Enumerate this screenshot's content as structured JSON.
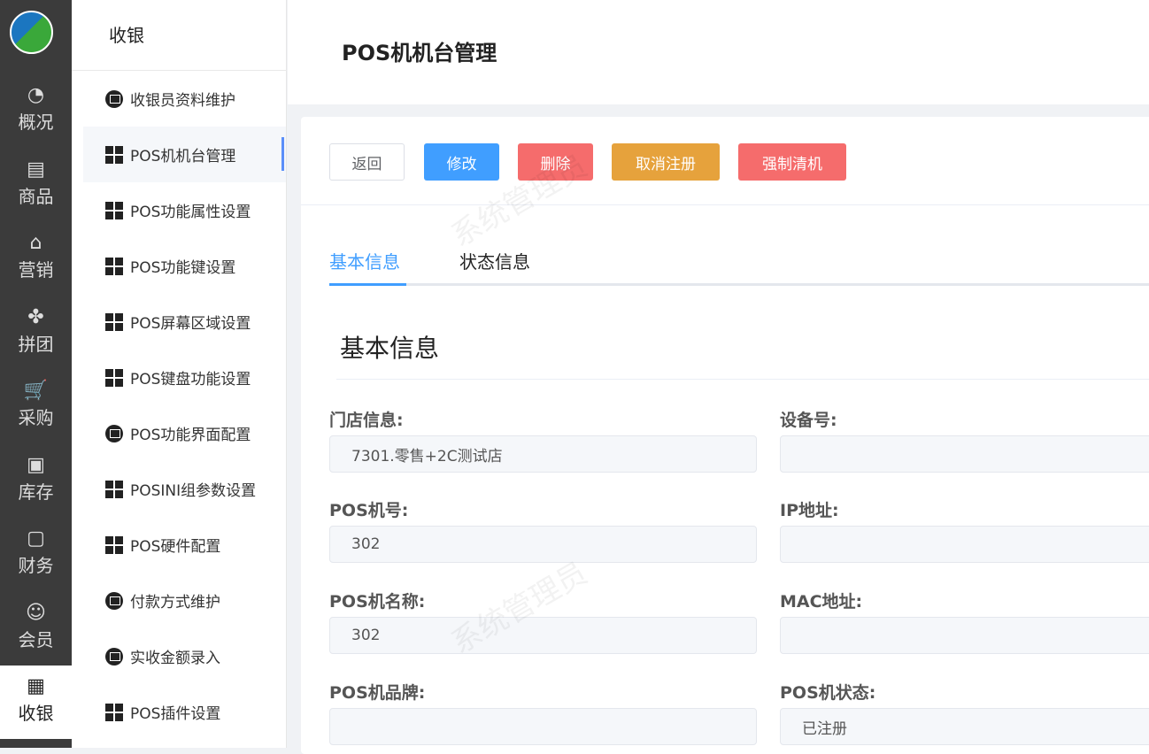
{
  "rail": [
    {
      "label": "概况",
      "icon": "dashboard-icon",
      "glyph": "◔"
    },
    {
      "label": "商品",
      "icon": "document-icon",
      "glyph": "▤"
    },
    {
      "label": "营销",
      "icon": "tag-icon",
      "glyph": "⌂"
    },
    {
      "label": "拼团",
      "icon": "clover-icon",
      "glyph": "✤"
    },
    {
      "label": "采购",
      "icon": "cart-icon",
      "glyph": "🛒"
    },
    {
      "label": "库存",
      "icon": "box-icon",
      "glyph": "▣"
    },
    {
      "label": "财务",
      "icon": "finance-icon",
      "glyph": "▢"
    },
    {
      "label": "会员",
      "icon": "user-icon",
      "glyph": "☺"
    },
    {
      "label": "收银",
      "icon": "cash-register-icon",
      "glyph": "▦"
    }
  ],
  "submenu": {
    "title": "收银",
    "items": [
      {
        "label": "收银员资料维护",
        "icon": "circle"
      },
      {
        "label": "POS机机台管理",
        "icon": "grid"
      },
      {
        "label": "POS功能属性设置",
        "icon": "grid"
      },
      {
        "label": "POS功能键设置",
        "icon": "grid"
      },
      {
        "label": "POS屏幕区域设置",
        "icon": "grid"
      },
      {
        "label": "POS键盘功能设置",
        "icon": "grid"
      },
      {
        "label": "POS功能界面配置",
        "icon": "circle"
      },
      {
        "label": "POSINI组参数设置",
        "icon": "grid"
      },
      {
        "label": "POS硬件配置",
        "icon": "grid"
      },
      {
        "label": "付款方式维护",
        "icon": "circle"
      },
      {
        "label": "实收金额录入",
        "icon": "circle"
      },
      {
        "label": "POS插件设置",
        "icon": "grid"
      }
    ]
  },
  "page_title": "POS机机台管理",
  "buttons": {
    "back": "返回",
    "edit": "修改",
    "delete": "删除",
    "unregister": "取消注册",
    "force_clear": "强制清机"
  },
  "tabs": [
    "基本信息",
    "状态信息"
  ],
  "section_title": "基本信息",
  "fields": {
    "store": {
      "label": "门店信息:",
      "value": "7301.零售+2C测试店"
    },
    "device_no": {
      "label": "设备号:",
      "value": ""
    },
    "pos_no": {
      "label": "POS机号:",
      "value": "302"
    },
    "ip": {
      "label": "IP地址:",
      "value": ""
    },
    "pos_name": {
      "label": "POS机名称:",
      "value": "302"
    },
    "mac": {
      "label": "MAC地址:",
      "value": ""
    },
    "brand": {
      "label": "POS机品牌:",
      "value": ""
    },
    "status": {
      "label": "POS机状态:",
      "value": "已注册"
    }
  },
  "watermark": "系统管理员",
  "colors": {
    "primary": "#409eff",
    "danger": "#f56c6c",
    "warning": "#e6a23c"
  }
}
